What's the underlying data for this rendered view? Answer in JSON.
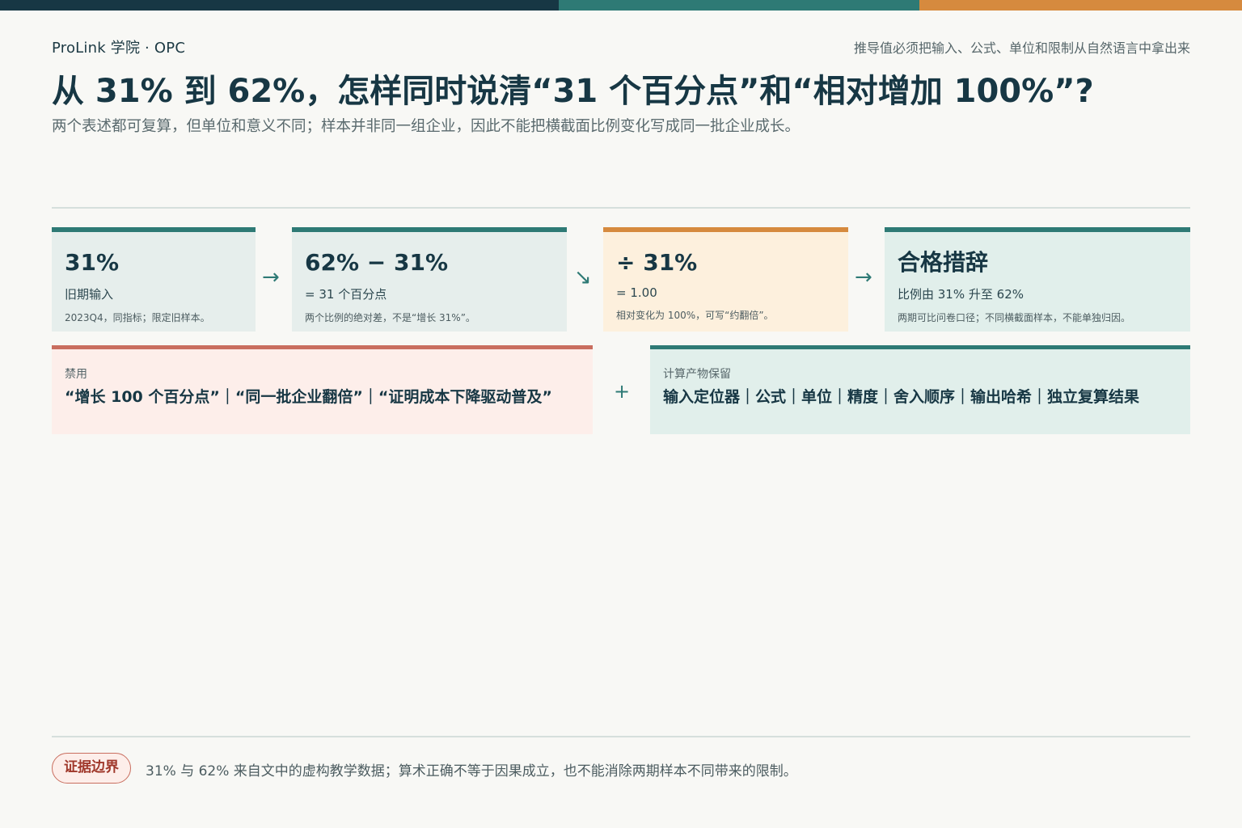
{
  "header": {
    "brand": "ProLink 学院 · OPC",
    "tagline": "推导值必须把输入、公式、单位和限制从自然语言中拿出来",
    "title": "从 31% 到 62%，怎样同时说清“31 个百分点”和“相对增加 100%”?",
    "subtitle": "两个表述都可复算，但单位和意义不同；样本并非同一组企业，因此不能把横截面比例变化写成同一批企业成长。"
  },
  "steps": [
    {
      "big": "31%",
      "mid": "旧期输入",
      "small": "2023Q4，同指标；限定旧样本。"
    },
    {
      "big": "62% − 31%",
      "mid": "= 31 个百分点",
      "small": "两个比例的绝对差，不是“增长 31%”。"
    },
    {
      "big": "÷ 31%",
      "mid": "= 1.00",
      "small": "相对变化为 100%，可写“约翻倍”。"
    },
    {
      "big": "合格措辞",
      "mid": "比例由 31% 升至 62%",
      "small": "两期可比问卷口径；不同横截面样本，不能单独归因。"
    }
  ],
  "arrows": [
    "→",
    "↘",
    "→"
  ],
  "banned": {
    "label": "禁用",
    "text": "“增长 100 个百分点”｜“同一批企业翻倍”｜“证明成本下降驱动普及”"
  },
  "plus": "+",
  "keep": {
    "label": "计算产物保留",
    "text": "输入定位器｜公式｜单位｜精度｜舍入顺序｜输出哈希｜独立复算结果"
  },
  "footer": {
    "badge": "证据边界",
    "note": "31% 与 62% 来自文中的虚构教学数据；算术正确不等于因果成立，也不能消除两期样本不同带来的限制。"
  },
  "colors": {
    "navy": "#173744",
    "teal": "#2e7a75",
    "orange": "#d68a3e",
    "red": "#c96e5f"
  }
}
